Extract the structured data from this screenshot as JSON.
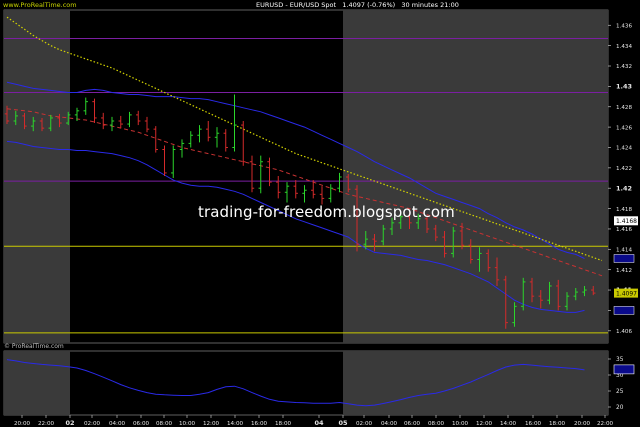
{
  "header": {
    "brand": "www.ProRealTime.com",
    "instrument": "EURUSD - EUR/USD Spot",
    "last_price": "1.4097",
    "change": "(-0.76%)",
    "timeframe": "30 minutes",
    "time": "21:00"
  },
  "sub_brand": "© ProRealTime.com",
  "watermark": "trading-for-freedom.blogspot.com",
  "colors": {
    "background": "#000000",
    "session_shading": "#3a3a3a",
    "up_bar": "#2bd52b",
    "down_bar": "#d42a2a",
    "bollinger": "#2a2ae8",
    "moving_average_long": "#d4d400",
    "moving_average_short": "#c83232",
    "horizontal_purple": "#7b1fa2",
    "horizontal_yellow": "#c9c900"
  },
  "chart_data": [
    {
      "type": "ohlc",
      "y_ticks": [
        "1.436",
        "1.434",
        "1.432",
        "1.43",
        "1.428",
        "1.426",
        "1.424",
        "1.422",
        "1.42",
        "1.418",
        "1.416",
        "1.414",
        "1.412",
        "1.41",
        "1.408",
        "1.406"
      ],
      "bold_y_ticks": [
        "1.43",
        "1.42",
        "1.41"
      ],
      "ylim": [
        1.4048,
        1.4375
      ],
      "x_tick_labels": [
        "20:00",
        "22:00",
        "02",
        "02:00",
        "04:00",
        "06:00",
        "08:00",
        "10:00",
        "12:00",
        "14:00",
        "16:00",
        "18:00",
        "04",
        "05",
        "02:00",
        "04:00",
        "06:00",
        "08:00",
        "10:00",
        "12:00",
        "14:00",
        "16:00",
        "18:00",
        "20:00",
        "22:00"
      ],
      "bold_x_ticks": [
        "02",
        "04",
        "05"
      ],
      "price_tags": [
        {
          "label": "1.4168",
          "value": 1.4168,
          "style": "white"
        },
        {
          "label": "1.4097",
          "value": 1.4097,
          "style": "yellow"
        }
      ],
      "horizontal_lines": [
        {
          "value": 1.4347,
          "color": "purple"
        },
        {
          "value": 1.4294,
          "color": "purple"
        },
        {
          "value": 1.4207,
          "color": "purple"
        },
        {
          "value": 1.4143,
          "color": "yellow"
        },
        {
          "value": 1.4058,
          "color": "yellow"
        }
      ],
      "series": [
        {
          "kind": "ohlc",
          "bars": [
            [
              1.4273,
              1.4281,
              1.4263,
              1.4266
            ],
            [
              1.4266,
              1.4276,
              1.4262,
              1.4271
            ],
            [
              1.4271,
              1.4274,
              1.4258,
              1.4261
            ],
            [
              1.4261,
              1.427,
              1.4256,
              1.4266
            ],
            [
              1.4266,
              1.4269,
              1.4256,
              1.4259
            ],
            [
              1.4259,
              1.4272,
              1.4256,
              1.4269
            ],
            [
              1.4269,
              1.4273,
              1.426,
              1.4264
            ],
            [
              1.4264,
              1.4275,
              1.4262,
              1.4272
            ],
            [
              1.4272,
              1.4279,
              1.4266,
              1.4276
            ],
            [
              1.4276,
              1.4289,
              1.4272,
              1.4285
            ],
            [
              1.4285,
              1.4288,
              1.4264,
              1.4269
            ],
            [
              1.4269,
              1.4274,
              1.4258,
              1.4262
            ],
            [
              1.4262,
              1.427,
              1.4256,
              1.4266
            ],
            [
              1.4266,
              1.4271,
              1.4259,
              1.4263
            ],
            [
              1.4263,
              1.4275,
              1.426,
              1.4272
            ],
            [
              1.4272,
              1.4276,
              1.4262,
              1.4266
            ],
            [
              1.4266,
              1.427,
              1.4255,
              1.4258
            ],
            [
              1.4258,
              1.4261,
              1.4235,
              1.4238
            ],
            [
              1.4238,
              1.4242,
              1.4212,
              1.4215
            ],
            [
              1.4215,
              1.4242,
              1.421,
              1.4238
            ],
            [
              1.4238,
              1.4248,
              1.423,
              1.4244
            ],
            [
              1.4244,
              1.4256,
              1.424,
              1.4252
            ],
            [
              1.4252,
              1.4262,
              1.4245,
              1.4258
            ],
            [
              1.4258,
              1.4266,
              1.4246,
              1.425
            ],
            [
              1.425,
              1.426,
              1.424,
              1.4254
            ],
            [
              1.4254,
              1.4258,
              1.4236,
              1.424
            ],
            [
              1.424,
              1.4292,
              1.4236,
              1.4262
            ],
            [
              1.4262,
              1.4266,
              1.4222,
              1.4226
            ],
            [
              1.4226,
              1.4232,
              1.4196,
              1.42
            ],
            [
              1.42,
              1.4232,
              1.4195,
              1.4226
            ],
            [
              1.4226,
              1.423,
              1.4202,
              1.4206
            ],
            [
              1.4206,
              1.4212,
              1.419,
              1.4196
            ],
            [
              1.4196,
              1.4206,
              1.4186,
              1.4202
            ],
            [
              1.4202,
              1.4208,
              1.419,
              1.4195
            ],
            [
              1.4195,
              1.4203,
              1.4186,
              1.4198
            ],
            [
              1.4198,
              1.4208,
              1.419,
              1.4194
            ],
            [
              1.4194,
              1.4202,
              1.4184,
              1.419
            ],
            [
              1.419,
              1.4204,
              1.4186,
              1.42
            ],
            [
              1.42,
              1.4215,
              1.4196,
              1.4211
            ],
            [
              1.4211,
              1.4214,
              1.4196,
              1.4199
            ],
            [
              1.4199,
              1.4203,
              1.4138,
              1.4145
            ],
            [
              1.4145,
              1.4158,
              1.414,
              1.415
            ],
            [
              1.415,
              1.4155,
              1.4138,
              1.4148
            ],
            [
              1.4148,
              1.4164,
              1.4144,
              1.416
            ],
            [
              1.416,
              1.4171,
              1.4154,
              1.4166
            ],
            [
              1.4166,
              1.4176,
              1.416,
              1.4172
            ],
            [
              1.4172,
              1.4176,
              1.416,
              1.4166
            ],
            [
              1.4166,
              1.4175,
              1.416,
              1.417
            ],
            [
              1.417,
              1.4172,
              1.4156,
              1.416
            ],
            [
              1.416,
              1.4164,
              1.4148,
              1.4152
            ],
            [
              1.4152,
              1.4158,
              1.4132,
              1.4136
            ],
            [
              1.4136,
              1.4162,
              1.4132,
              1.4158
            ],
            [
              1.4158,
              1.4166,
              1.414,
              1.4144
            ],
            [
              1.4144,
              1.415,
              1.4126,
              1.413
            ],
            [
              1.413,
              1.4142,
              1.4118,
              1.4136
            ],
            [
              1.4136,
              1.414,
              1.4118,
              1.4122
            ],
            [
              1.4122,
              1.4132,
              1.4104,
              1.411
            ],
            [
              1.411,
              1.4114,
              1.4062,
              1.4068
            ],
            [
              1.4068,
              1.4088,
              1.4064,
              1.4084
            ],
            [
              1.4084,
              1.4112,
              1.408,
              1.4108
            ],
            [
              1.4108,
              1.4112,
              1.4088,
              1.4094
            ],
            [
              1.4094,
              1.41,
              1.4082,
              1.409
            ],
            [
              1.409,
              1.4108,
              1.4086,
              1.4104
            ],
            [
              1.4104,
              1.411,
              1.408,
              1.4084
            ],
            [
              1.4084,
              1.4098,
              1.408,
              1.4094
            ],
            [
              1.4094,
              1.4102,
              1.409,
              1.4098
            ],
            [
              1.4098,
              1.4104,
              1.4094,
              1.41
            ],
            [
              1.41,
              1.4104,
              1.4095,
              1.4097
            ]
          ]
        },
        {
          "kind": "bollinger_upper",
          "values": [
            1.4304,
            1.4302,
            1.43,
            1.4298,
            1.4297,
            1.4296,
            1.4295,
            1.4294,
            1.4294,
            1.4296,
            1.4297,
            1.4296,
            1.4294,
            1.4293,
            1.4292,
            1.4292,
            1.4291,
            1.429,
            1.429,
            1.429,
            1.4289,
            1.4288,
            1.4288,
            1.4287,
            1.4285,
            1.4283,
            1.4281,
            1.4279,
            1.4277,
            1.4275,
            1.4272,
            1.4269,
            1.4266,
            1.4263,
            1.426,
            1.4256,
            1.4252,
            1.4248,
            1.4244,
            1.424,
            1.4236,
            1.4231,
            1.4226,
            1.4222,
            1.4218,
            1.4214,
            1.421,
            1.4205,
            1.42,
            1.4195,
            1.4192,
            1.4189,
            1.4186,
            1.4183,
            1.418,
            1.4175,
            1.4171,
            1.4166,
            1.4162,
            1.4159,
            1.4155,
            1.415,
            1.4145,
            1.414,
            1.4137,
            1.4135,
            1.4131
          ]
        },
        {
          "kind": "bollinger_lower",
          "values": [
            1.4246,
            1.4245,
            1.4243,
            1.4241,
            1.424,
            1.4239,
            1.4238,
            1.4238,
            1.4237,
            1.4237,
            1.4236,
            1.4235,
            1.4234,
            1.4232,
            1.423,
            1.4227,
            1.4223,
            1.4218,
            1.4213,
            1.4208,
            1.4205,
            1.4203,
            1.4202,
            1.4202,
            1.4201,
            1.4199,
            1.4197,
            1.4194,
            1.419,
            1.4186,
            1.4182,
            1.4178,
            1.4174,
            1.417,
            1.4167,
            1.4164,
            1.4161,
            1.4158,
            1.4155,
            1.4152,
            1.4146,
            1.4141,
            1.4137,
            1.4136,
            1.4135,
            1.4134,
            1.4132,
            1.413,
            1.4129,
            1.4127,
            1.4125,
            1.4122,
            1.4119,
            1.4116,
            1.4112,
            1.4108,
            1.4102,
            1.4096,
            1.409,
            1.4086,
            1.4083,
            1.4081,
            1.408,
            1.4079,
            1.4078,
            1.4078,
            1.408
          ]
        },
        {
          "kind": "moving_average_long",
          "values": [
            1.4368,
            1.4362,
            1.4356,
            1.435,
            1.4345,
            1.434,
            1.4336,
            1.4333,
            1.433,
            1.4327,
            1.4324,
            1.4321,
            1.4318,
            1.4314,
            1.431,
            1.4306,
            1.4302,
            1.4298,
            1.4294,
            1.429,
            1.4286,
            1.4282,
            1.4278,
            1.4274,
            1.427,
            1.4266,
            1.4262,
            1.4258,
            1.4254,
            1.425,
            1.4246,
            1.4242,
            1.4238,
            1.4234,
            1.4231,
            1.4228,
            1.4225,
            1.4222,
            1.4219,
            1.4216,
            1.4213,
            1.421,
            1.4207,
            1.4204,
            1.4201,
            1.4198,
            1.4195,
            1.4192,
            1.4189,
            1.4186,
            1.4183,
            1.418,
            1.4177,
            1.4174,
            1.4171,
            1.4168,
            1.4165,
            1.4162,
            1.4159,
            1.4156,
            1.4153,
            1.415,
            1.4147,
            1.4144,
            1.4141,
            1.4138,
            1.4135,
            1.4132,
            1.4129
          ]
        },
        {
          "kind": "moving_average_short",
          "values": [
            1.4278,
            1.4277,
            1.4276,
            1.4275,
            1.4273,
            1.4271,
            1.427,
            1.4269,
            1.4268,
            1.4267,
            1.4265,
            1.4263,
            1.4261,
            1.4259,
            1.4257,
            1.4255,
            1.4252,
            1.4249,
            1.4246,
            1.4243,
            1.424,
            1.4238,
            1.4236,
            1.4234,
            1.4232,
            1.423,
            1.4228,
            1.4226,
            1.4224,
            1.4222,
            1.422,
            1.4218,
            1.4215,
            1.4212,
            1.4209,
            1.4206,
            1.4203,
            1.42,
            1.4197,
            1.4194,
            1.4192,
            1.419,
            1.4188,
            1.4186,
            1.4184,
            1.4182,
            1.418,
            1.4177,
            1.4174,
            1.4171,
            1.4168,
            1.4165,
            1.4162,
            1.4159,
            1.4156,
            1.4153,
            1.415,
            1.4147,
            1.4144,
            1.4141,
            1.4138,
            1.4135,
            1.4132,
            1.4129,
            1.4126,
            1.4123,
            1.412,
            1.4117,
            1.4114
          ]
        }
      ]
    },
    {
      "type": "line",
      "name": "indicator",
      "y_ticks": [
        "35",
        "30",
        "25",
        "20"
      ],
      "ylim": [
        17.5,
        37.5
      ],
      "value_tag": "",
      "series": [
        {
          "kind": "indicator_line",
          "values": [
            34.8,
            34.4,
            33.9,
            33.6,
            33.3,
            33.1,
            32.9,
            32.6,
            32.2,
            31.4,
            30.4,
            29.3,
            28.2,
            27.0,
            26.0,
            25.2,
            24.5,
            24.0,
            23.8,
            23.7,
            23.6,
            23.6,
            24.0,
            24.5,
            25.5,
            26.3,
            26.5,
            25.7,
            24.5,
            23.4,
            22.4,
            21.8,
            21.6,
            21.4,
            21.3,
            21.2,
            21.2,
            21.2,
            21.4,
            21.0,
            20.6,
            20.4,
            20.6,
            21.1,
            21.7,
            22.3,
            23.0,
            23.6,
            24.0,
            24.3,
            25.0,
            25.8,
            26.8,
            27.8,
            29.0,
            30.2,
            31.4,
            32.5,
            33.1,
            33.3,
            33.1,
            32.8,
            32.6,
            32.4,
            32.2,
            32.0,
            31.6
          ]
        }
      ]
    }
  ]
}
